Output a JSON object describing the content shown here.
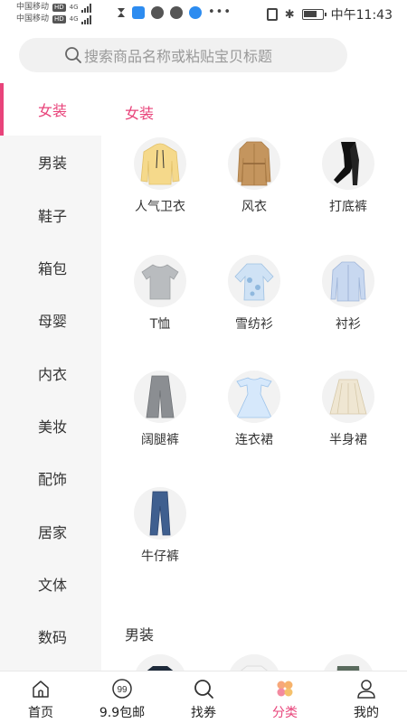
{
  "status_bar": {
    "carrier1": "中国移动",
    "carrier2": "中国移动",
    "hd_badge": "HD",
    "net1": "4G",
    "net2": "4G",
    "time": "中午11:43"
  },
  "search": {
    "placeholder": "搜索商品名称或粘贴宝贝标题"
  },
  "sidebar": {
    "active_color": "#e8437a",
    "items": [
      {
        "label": "女装",
        "active": true
      },
      {
        "label": "男装"
      },
      {
        "label": "鞋子"
      },
      {
        "label": "箱包"
      },
      {
        "label": "母婴"
      },
      {
        "label": "内衣"
      },
      {
        "label": "美妆"
      },
      {
        "label": "配饰"
      },
      {
        "label": "居家"
      },
      {
        "label": "文体"
      },
      {
        "label": "数码"
      }
    ]
  },
  "sections": [
    {
      "title": "女装",
      "items": [
        {
          "label": "人气卫衣",
          "icon": "hoodie-icon"
        },
        {
          "label": "风衣",
          "icon": "trench-coat-icon"
        },
        {
          "label": "打底裤",
          "icon": "leggings-icon"
        },
        {
          "label": "T恤",
          "icon": "tshirt-icon"
        },
        {
          "label": "雪纺衫",
          "icon": "chiffon-blouse-icon"
        },
        {
          "label": "衬衫",
          "icon": "shirt-icon"
        },
        {
          "label": "阔腿裤",
          "icon": "wide-leg-pants-icon"
        },
        {
          "label": "连衣裙",
          "icon": "dress-icon"
        },
        {
          "label": "半身裙",
          "icon": "skirt-icon"
        },
        {
          "label": "牛仔裤",
          "icon": "jeans-icon"
        }
      ]
    },
    {
      "title": "男装"
    }
  ],
  "bottom_nav": {
    "active_color": "#e8437a",
    "items": [
      {
        "label": "首页",
        "icon": "home-icon"
      },
      {
        "label": "9.9包邮",
        "icon": "nine-nine-icon"
      },
      {
        "label": "找券",
        "icon": "search-icon"
      },
      {
        "label": "分类",
        "icon": "category-icon",
        "active": true
      },
      {
        "label": "我的",
        "icon": "profile-icon"
      }
    ]
  }
}
